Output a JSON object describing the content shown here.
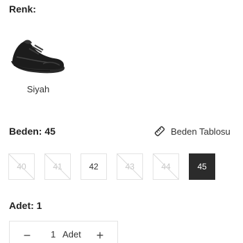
{
  "color_section": {
    "label": "Renk:",
    "selected_color": "Siyah",
    "image_icon": "black-sneaker-image"
  },
  "size_section": {
    "label": "Beden: 45",
    "size_guide_label": "Beden Tablosu",
    "size_guide_icon": "ruler-icon",
    "sizes": [
      {
        "label": "40",
        "available": false,
        "selected": false
      },
      {
        "label": "41",
        "available": false,
        "selected": false
      },
      {
        "label": "42",
        "available": true,
        "selected": false
      },
      {
        "label": "43",
        "available": false,
        "selected": false
      },
      {
        "label": "44",
        "available": false,
        "selected": false
      },
      {
        "label": "45",
        "available": true,
        "selected": true
      }
    ]
  },
  "quantity_section": {
    "label": "Adet: 1",
    "minus_symbol": "−",
    "value": "1",
    "unit": "Adet",
    "plus_symbol": "+"
  },
  "colors": {
    "selected_size_bg": "#2b2b2b",
    "border": "#e3e3e3",
    "disabled_text": "#c7c7c7"
  }
}
